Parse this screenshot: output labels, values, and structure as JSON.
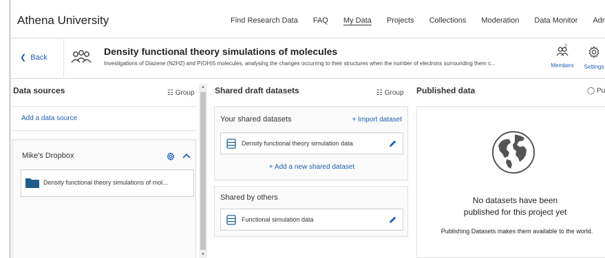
{
  "app": {
    "brand": "Athena University"
  },
  "nav": {
    "items": [
      "Find Research Data",
      "FAQ",
      "My Data",
      "Projects",
      "Collections",
      "Moderation",
      "Data Monitor",
      "Admin"
    ],
    "active_index": 2
  },
  "project": {
    "back_label": "Back",
    "title": "Density functional theory simulations of molecules",
    "description": "Investigations of Diazene (N2H2) and P(OH)5 molecules, analysing the changes occurring to their structures when the number of electrons surrounding them c...",
    "members_label": "Members",
    "members_count": "2",
    "settings_label": "Settings"
  },
  "data_sources": {
    "title": "Data sources",
    "group_label": "Group",
    "add_label": "Add a data source",
    "source": {
      "name": "Mike's Dropbox",
      "items": [
        "Density functional theory simulations of mol..."
      ]
    }
  },
  "shared_drafts": {
    "title": "Shared draft datasets",
    "group_label": "Group",
    "yours": {
      "title": "Your shared datasets",
      "import_label": "+ Import dataset",
      "items": [
        "Density functional theory simulation data"
      ],
      "add_label": "+  Add a new shared dataset"
    },
    "others": {
      "title": "Shared by others",
      "items": [
        "Functional simulation data"
      ]
    }
  },
  "published": {
    "title": "Published data",
    "visibility_label": "Publi",
    "empty_message": "No datasets have been published for this project yet",
    "hint": "Publishing Datasets makes them available to the world."
  },
  "colors": {
    "link": "#1a5fb4",
    "folder": "#1f5d8c"
  }
}
